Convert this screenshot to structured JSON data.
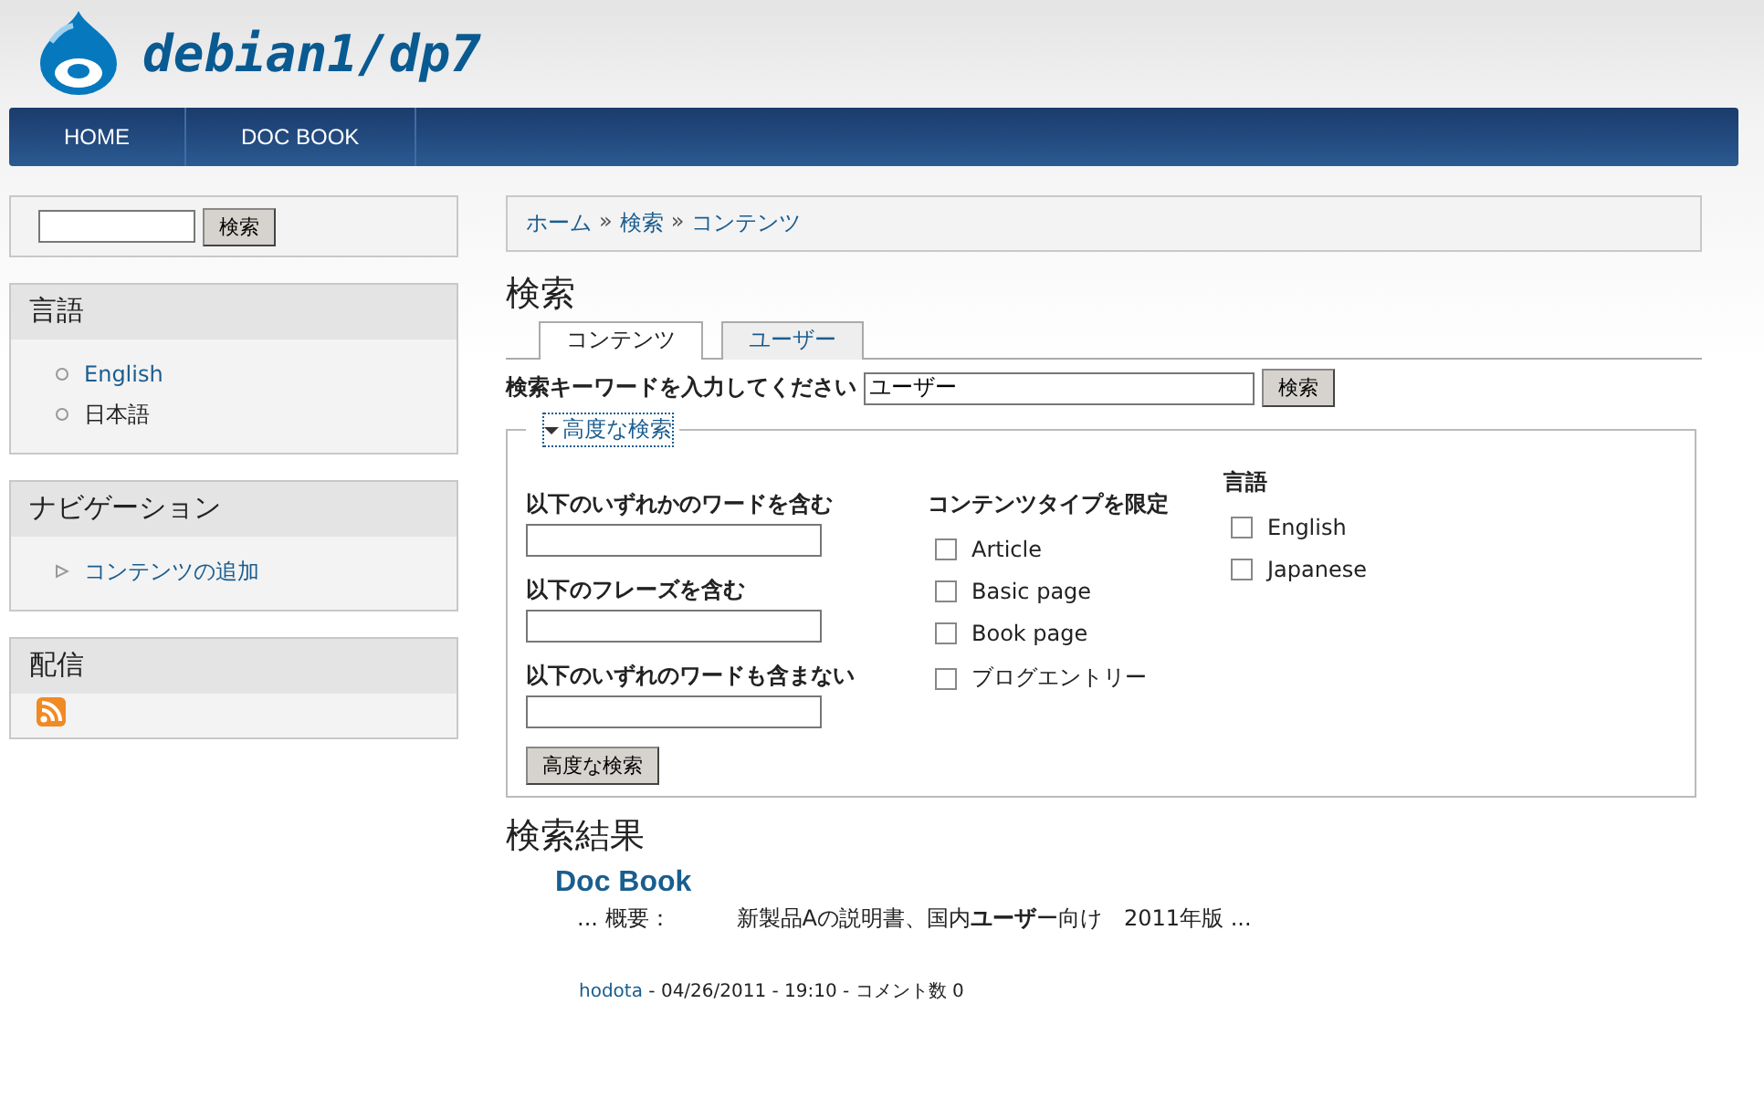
{
  "site": {
    "name": "debian1/dp7"
  },
  "nav": [
    {
      "label": "HOME",
      "selected": false
    },
    {
      "label": "DOC BOOK",
      "selected": false
    }
  ],
  "sidebar": {
    "search": {
      "button": "検索"
    },
    "blocks": [
      {
        "kind": "list",
        "title": "言語",
        "items": [
          {
            "label": "English",
            "link": true
          },
          {
            "label": "日本語",
            "link": false
          }
        ]
      },
      {
        "kind": "nav",
        "title": "ナビゲーション",
        "items": [
          {
            "label": "コンテンツの追加",
            "link": true
          }
        ]
      },
      {
        "kind": "feed",
        "title": "配信"
      }
    ]
  },
  "breadcrumb": {
    "separator": "»",
    "items": [
      "ホーム",
      "検索",
      "コンテンツ"
    ]
  },
  "page_title": "検索",
  "tabs": [
    {
      "label": "コンテンツ",
      "selected": true
    },
    {
      "label": "ユーザー",
      "selected": false
    }
  ],
  "search": {
    "label": "検索キーワードを入力してください",
    "value": "ユーザー",
    "button": "検索"
  },
  "advanced": {
    "legend": "高度な検索",
    "expanded": true,
    "fields": [
      "以下のいずれかのワードを含む",
      "以下のフレーズを含む",
      "以下のいずれのワードも含まない"
    ],
    "types": {
      "title": "コンテンツタイプを限定",
      "options": [
        {
          "label": "Article",
          "checked": false
        },
        {
          "label": "Basic page",
          "checked": false
        },
        {
          "label": "Book page",
          "checked": false
        },
        {
          "label": "ブログエントリー",
          "checked": false
        }
      ]
    },
    "languages": {
      "title": "言語",
      "options": [
        {
          "label": "English",
          "checked": false
        },
        {
          "label": "Japanese",
          "checked": false
        }
      ]
    },
    "button": "高度な検索"
  },
  "results": {
    "title": "検索結果",
    "items": [
      {
        "title": "Doc Book",
        "snippet": "... 概要：　　　新製品Aの説明書、国内**ユーザ**ー向け　2011年版 ...",
        "author": "hodota",
        "meta": " - 04/26/2011 - 19:10 - コメント数  0"
      }
    ]
  }
}
